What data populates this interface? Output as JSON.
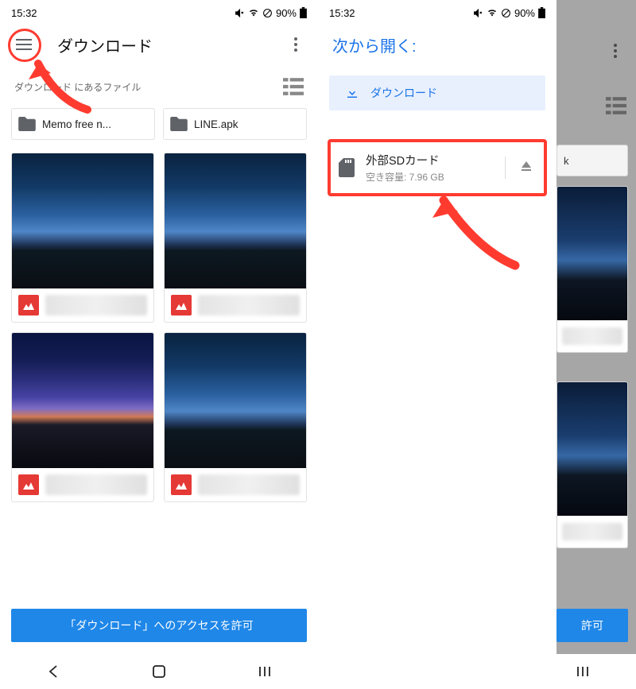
{
  "status": {
    "time": "15:32",
    "battery_pct": "90%"
  },
  "left": {
    "title": "ダウンロード",
    "subheader": "ダウンロード にあるファイル",
    "folders": [
      "Memo free n...",
      "LINE.apk"
    ],
    "access_btn": "「ダウンロード」へのアクセスを許可"
  },
  "right": {
    "drawer_title": "次から開く:",
    "download_label": "ダウンロード",
    "sd_title": "外部SDカード",
    "sd_free": "空き容量: 7.96 GB",
    "dim_folder_tail": "k",
    "dim_access_tail": "許可"
  }
}
